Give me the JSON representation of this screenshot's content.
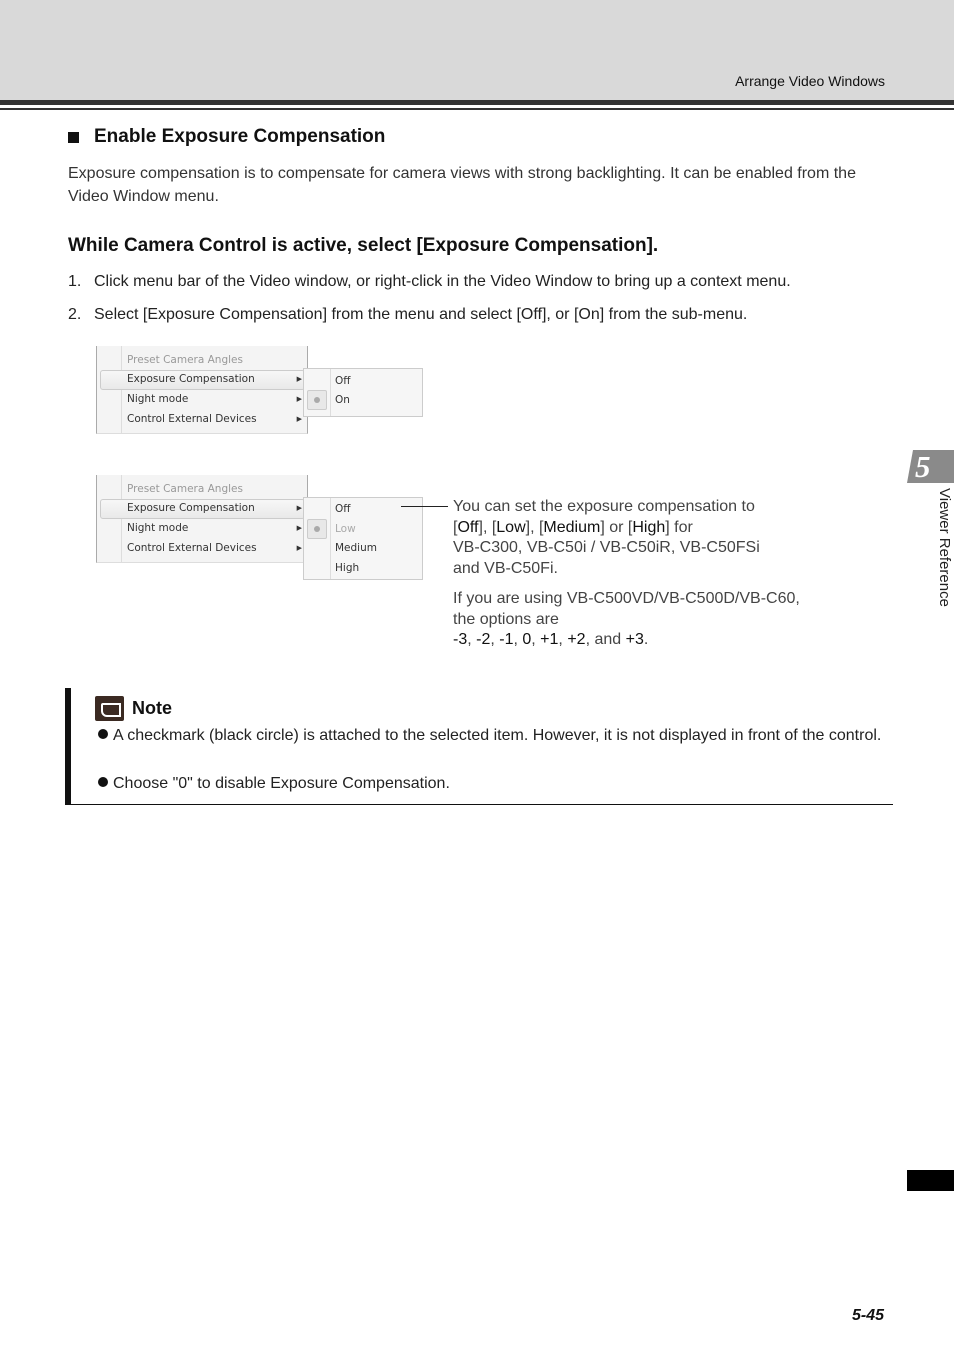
{
  "header": {
    "title": "Arrange Video Windows"
  },
  "section": {
    "title": "Enable Exposure Compensation",
    "intro": "Exposure compensation is to compensate for camera views with strong backlighting. It can be enabled from the Video Window menu."
  },
  "procedure": {
    "title": "While Camera Control is active, select [Exposure Compensation].",
    "steps": [
      {
        "num": "1.",
        "text": "Click menu bar of the Video window, or right-click in the Video Window to bring up a context menu."
      },
      {
        "num": "2.",
        "text": "Select [Exposure Compensation] from the menu and select [Off], or [On] from the sub-menu."
      }
    ]
  },
  "menu1": {
    "items": [
      {
        "label": "Preset Camera Angles",
        "disabled": true
      },
      {
        "label": "Exposure Compensation",
        "highlighted": true,
        "arrow": "▶"
      },
      {
        "label": "Night mode",
        "arrow": "▶"
      },
      {
        "label": "Control External Devices",
        "arrow": "▶"
      }
    ],
    "submenu": [
      {
        "label": "Off"
      },
      {
        "label": "On",
        "selected": true
      }
    ]
  },
  "menu2": {
    "items": [
      {
        "label": "Preset Camera Angles",
        "disabled": true
      },
      {
        "label": "Exposure Compensation",
        "highlighted": true,
        "arrow": "▶"
      },
      {
        "label": "Night mode",
        "arrow": "▶"
      },
      {
        "label": "Control External Devices",
        "arrow": "▶"
      }
    ],
    "submenu": [
      {
        "label": "Off"
      },
      {
        "label": "Low",
        "selected": true,
        "disabled": true
      },
      {
        "label": "Medium"
      },
      {
        "label": "High"
      }
    ]
  },
  "callout": {
    "p1": {
      "a": "You can set the exposure compensation to",
      "b1": "[",
      "off": "Off",
      "b2": "], [",
      "low": "Low",
      "b3": "], [",
      "medium": "Medium",
      "b4": "] or [",
      "high": "High",
      "b5": "] for",
      "c": "VB-C300, VB-C50i / VB-C50iR, VB-C50FSi",
      "d": "and VB-C50Fi."
    },
    "p2": {
      "a": "If you are using VB-C500VD/VB-C500D/VB-C60,",
      "b": "the options are",
      "values": [
        "-3",
        "-2",
        "-1",
        "0",
        "+1",
        "+2"
      ],
      "and": "and",
      "last": "+3"
    }
  },
  "note": {
    "title": "Note",
    "items": [
      "A checkmark (black circle) is attached to the selected item. However, it is not displayed in front of the control.",
      "Choose \"0\" to disable Exposure Compensation."
    ]
  },
  "chapter": {
    "number": "5",
    "label": "Viewer Reference"
  },
  "page_number": "5-45"
}
